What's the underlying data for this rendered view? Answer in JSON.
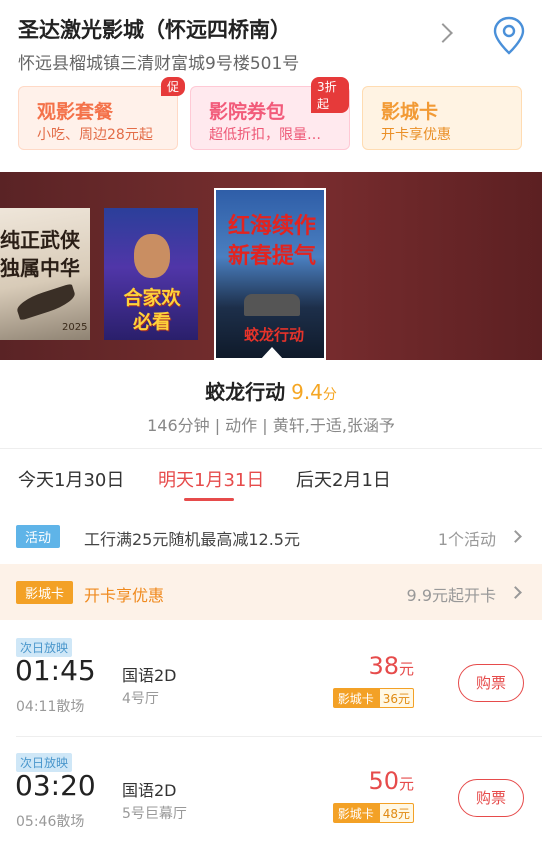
{
  "cinema": {
    "name": "圣达激光影城（怀远四桥南）",
    "address": "怀远县榴城镇三清财富城9号楼501号",
    "location_icon": "location-pin-icon"
  },
  "cards": [
    {
      "title": "观影套餐",
      "sub": "小吃、周边28元起",
      "badge": "促"
    },
    {
      "title": "影院券包",
      "sub": "超低折扣，限量…",
      "badge": "3折起"
    },
    {
      "title": "影城卡",
      "sub": "开卡享优惠",
      "badge": ""
    }
  ],
  "posters": {
    "p1_text_line1": "纯正武侠",
    "p1_text_line2": "独属中华",
    "p1_year": "2025",
    "p2_text_line1": "合家欢",
    "p2_text_line2": "必看",
    "p3_text_line1": "红海续作",
    "p3_text_line2": "新春提气",
    "p3_logo": "蛟龙行动"
  },
  "movie": {
    "name": "蛟龙行动",
    "score": "9.4",
    "score_unit": "分",
    "meta": "146分钟 | 动作 | 黄轩,于适,张涵予"
  },
  "dates": [
    {
      "label": "今天1月30日",
      "active": false
    },
    {
      "label": "明天1月31日",
      "active": true
    },
    {
      "label": "后天2月1日",
      "active": false
    }
  ],
  "promos": {
    "activity": {
      "tag": "活动",
      "text": "工行满25元随机最高减12.5元",
      "right": "1个活动"
    },
    "card": {
      "tag": "影城卡",
      "text": "开卡享优惠",
      "right": "9.9元起开卡"
    }
  },
  "showtimes": [
    {
      "next_day": "次日放映",
      "start": "01:45",
      "end": "04:11散场",
      "lang": "国语2D",
      "hall": "4号厅",
      "price": "38",
      "price_unit": "元",
      "card_label": "影城卡",
      "card_price": "36元",
      "buy": "购票"
    },
    {
      "next_day": "次日放映",
      "start": "03:20",
      "end": "05:46散场",
      "lang": "国语2D",
      "hall": "5号巨幕厅",
      "price": "50",
      "price_unit": "元",
      "card_label": "影城卡",
      "card_price": "48元",
      "buy": "购票"
    }
  ],
  "colors": {
    "accent": "#e64b4b",
    "score": "#f5a623",
    "card_orange": "#f3a126"
  }
}
